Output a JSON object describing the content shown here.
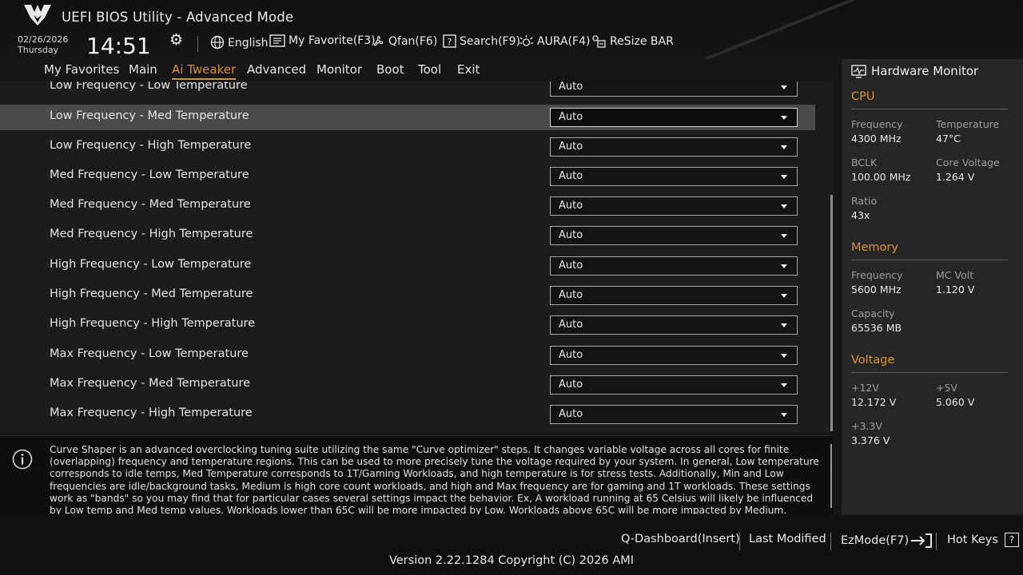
{
  "header": {
    "title": "UEFI BIOS Utility - Advanced Mode",
    "date": "02/26/2026",
    "day": "Thursday",
    "time": "14:51",
    "icons": [
      "tuf-logo",
      "gear-icon",
      "globe-icon",
      "favorite-icon",
      "fan-icon",
      "search-icon",
      "aura-icon",
      "resize-bar-icon"
    ],
    "tools": {
      "language": "English",
      "my_favorite": "My Favorite(F3)",
      "qfan": "Qfan(F6)",
      "search": "Search(F9)",
      "aura": "AURA(F4)",
      "resize_bar": "ReSize BAR"
    }
  },
  "nav": {
    "items": [
      "My Favorites",
      "Main",
      "Ai Tweaker",
      "Advanced",
      "Monitor",
      "Boot",
      "Tool",
      "Exit"
    ],
    "active": "Ai Tweaker",
    "accent_color": "#d78f3c"
  },
  "settings": {
    "rows": [
      {
        "label": "Low Frequency - Low Temperature",
        "value": "Auto"
      },
      {
        "label": "Low Frequency - Med Temperature",
        "value": "Auto",
        "selected": true
      },
      {
        "label": "Low Frequency - High Temperature",
        "value": "Auto"
      },
      {
        "label": "Med Frequency - Low Temperature",
        "value": "Auto"
      },
      {
        "label": "Med Frequency - Med Temperature",
        "value": "Auto"
      },
      {
        "label": "Med Frequency - High Temperature",
        "value": "Auto"
      },
      {
        "label": "High Frequency - Low Temperature",
        "value": "Auto"
      },
      {
        "label": "High Frequency - Med Temperature",
        "value": "Auto"
      },
      {
        "label": "High Frequency - High Temperature",
        "value": "Auto"
      },
      {
        "label": "Max Frequency - Low Temperature",
        "value": "Auto"
      },
      {
        "label": "Max Frequency - Med Temperature",
        "value": "Auto"
      },
      {
        "label": "Max Frequency - High Temperature",
        "value": "Auto"
      }
    ]
  },
  "help": {
    "text": "Curve Shaper is an advanced overclocking tuning suite utilizing the same \"Curve optimizer\" steps. It changes variable voltage across all cores for finite (overlapping) frequency and temperature regions. This can be used to more precisely tune the voltage required by your system. In general, Low temperature corresponds to idle temps, Med Temperature corresponds to 1T/Gaming Workloads, and high temperature is for stress tests. Additionally, Min and Low frequencies are idle/background tasks, Medium is high core count workloads, and high and Max frequency are for gaming and 1T workloads. These settings work as \"bands\" so you may find that for particular cases several settings impact the behavior. Ex, A workload running at 65 Celsius will likely be influenced by Low temp and Med temp values. Workloads lower than 65C will be more impacted by Low. Workloads above 65C will be more impacted by Medium."
  },
  "hardware_monitor": {
    "title": "Hardware Monitor",
    "cpu": {
      "heading": "CPU",
      "frequency_label": "Frequency",
      "frequency": "4300 MHz",
      "temperature_label": "Temperature",
      "temperature": "47°C",
      "bclk_label": "BCLK",
      "bclk": "100.00 MHz",
      "core_voltage_label": "Core Voltage",
      "core_voltage": "1.264 V",
      "ratio_label": "Ratio",
      "ratio": "43x"
    },
    "memory": {
      "heading": "Memory",
      "frequency_label": "Frequency",
      "frequency": "5600 MHz",
      "mc_volt_label": "MC Volt",
      "mc_volt": "1.120 V",
      "capacity_label": "Capacity",
      "capacity": "65536 MB"
    },
    "voltage": {
      "heading": "Voltage",
      "v12_label": "+12V",
      "v12": "12.172 V",
      "v5_label": "+5V",
      "v5": "5.060 V",
      "v33_label": "+3.3V",
      "v33": "3.376 V"
    },
    "accent_color": "#d99140"
  },
  "footer": {
    "q_dashboard": "Q-Dashboard(Insert)",
    "last_modified": "Last Modified",
    "ezmode": "EzMode(F7)",
    "hot_keys": "Hot Keys",
    "hot_keys_icon": "?",
    "version": "Version 2.22.1284 Copyright (C) 2026 AMI"
  }
}
